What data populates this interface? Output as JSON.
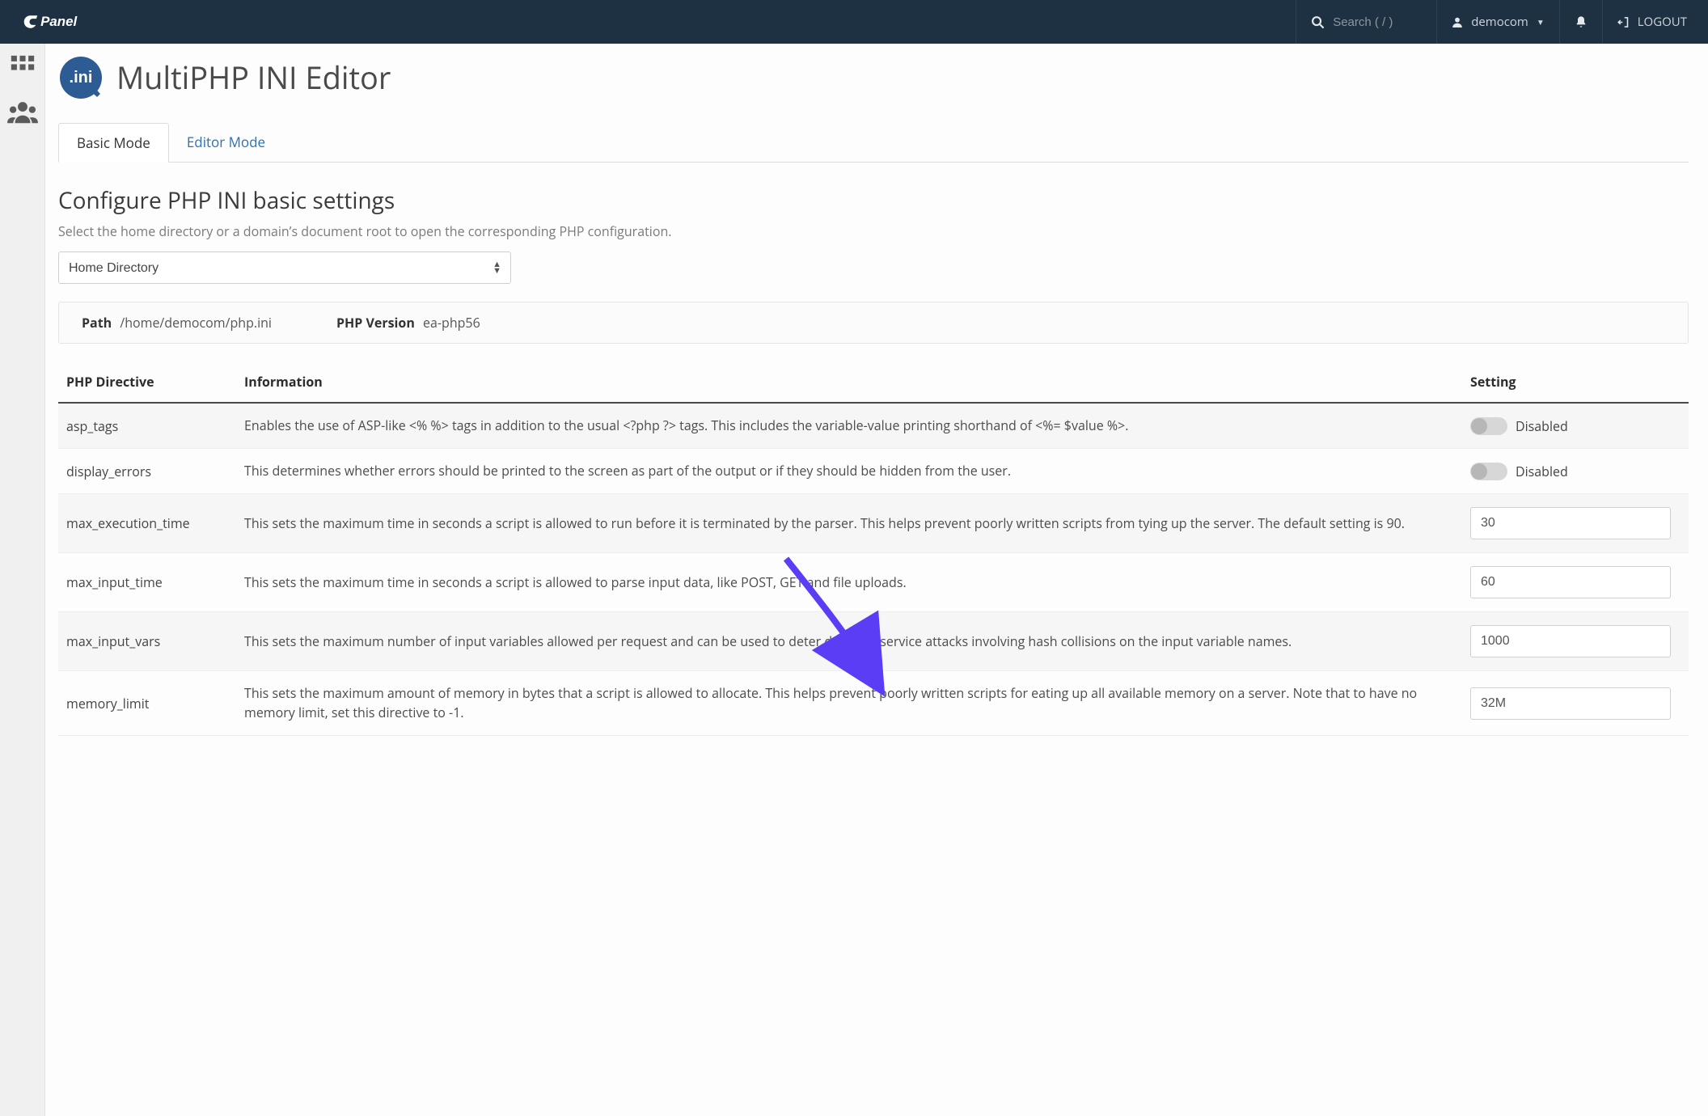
{
  "header": {
    "search_placeholder": "Search ( / )",
    "username": "democom",
    "logout_label": "LOGOUT"
  },
  "page": {
    "title": "MultiPHP INI Editor",
    "tabs": [
      {
        "label": "Basic Mode"
      },
      {
        "label": "Editor Mode"
      }
    ],
    "section_title": "Configure PHP INI basic settings",
    "section_sub": "Select the home directory or a domain’s document root to open the corresponding PHP configuration.",
    "location_select": "Home Directory",
    "info": {
      "path_label": "Path",
      "path_value": "/home/democom/php.ini",
      "ver_label": "PHP Version",
      "ver_value": "ea-php56"
    },
    "table_headers": {
      "directive": "PHP Directive",
      "information": "Information",
      "setting": "Setting"
    },
    "rows": [
      {
        "name": "asp_tags",
        "info": "Enables the use of ASP-like <% %> tags in addition to the usual <?php ?> tags. This includes the variable-value printing shorthand of <%= $value %>.",
        "type": "toggle",
        "status": "Disabled"
      },
      {
        "name": "display_errors",
        "info": "This determines whether errors should be printed to the screen as part of the output or if they should be hidden from the user.",
        "type": "toggle",
        "status": "Disabled"
      },
      {
        "name": "max_execution_time",
        "info": "This sets the maximum time in seconds a script is allowed to run before it is terminated by the parser. This helps prevent poorly written scripts from tying up the server. The default setting is 90.",
        "type": "text",
        "value": "30"
      },
      {
        "name": "max_input_time",
        "info": "This sets the maximum time in seconds a script is allowed to parse input data, like POST, GET and file uploads.",
        "type": "text",
        "value": "60"
      },
      {
        "name": "max_input_vars",
        "info": "This sets the maximum number of input variables allowed per request and can be used to deter denial of service attacks involving hash collisions on the input variable names.",
        "type": "text",
        "value": "1000"
      },
      {
        "name": "memory_limit",
        "info": "This sets the maximum amount of memory in bytes that a script is allowed to allocate. This helps prevent poorly written scripts for eating up all available memory on a server. Note that to have no memory limit, set this directive to -1.",
        "type": "text",
        "value": "32M"
      }
    ]
  }
}
